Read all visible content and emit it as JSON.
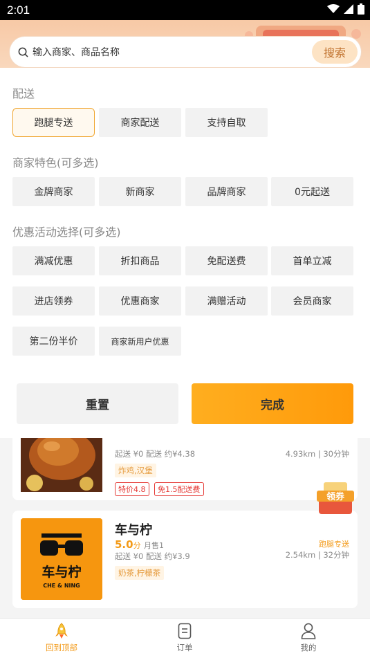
{
  "status_bar": {
    "time": "2:01"
  },
  "search": {
    "placeholder": "输入商家、商品名称",
    "button": "搜索"
  },
  "filter": {
    "delivery": {
      "title": "配送",
      "options": [
        "跑腿专送",
        "商家配送",
        "支持自取"
      ],
      "selected": "跑腿专送"
    },
    "features": {
      "title": "商家特色(可多选)",
      "options": [
        "金牌商家",
        "新商家",
        "品牌商家",
        "0元起送"
      ]
    },
    "promotions": {
      "title": "优惠活动选择(可多选)",
      "options": [
        "满减优惠",
        "折扣商品",
        "免配送费",
        "首单立减",
        "进店领券",
        "优惠商家",
        "满赠活动",
        "会员商家",
        "第二份半价",
        "商家新用户优惠"
      ]
    },
    "reset_label": "重置",
    "done_label": "完成"
  },
  "stores": [
    {
      "fees": "起送 ¥0  配送 约¥4.38",
      "distance": "4.93km | 30分钟",
      "category": "炸鸡,汉堡",
      "badges": [
        "特价4.8",
        "免1.5配送费"
      ]
    },
    {
      "name": "车与柠",
      "rating": "5.0",
      "rating_unit": "分",
      "monthly_sales": "月售1",
      "fees": "起送 ¥0  配送 约¥3.9",
      "delivery_type": "跑腿专送",
      "distance": "2.54km | 32分钟",
      "category": "奶茶,柠檬茶",
      "logo_text": "车与柠",
      "logo_subtext": "CHE & NING"
    }
  ],
  "coupon": {
    "label": "领券"
  },
  "tabbar": {
    "items": [
      {
        "label": "回到顶部",
        "icon": "rocket-icon"
      },
      {
        "label": "订单",
        "icon": "order-icon"
      },
      {
        "label": "我的",
        "icon": "user-icon"
      }
    ],
    "active": "回到顶部"
  },
  "colors": {
    "accent": "#F39A18",
    "done_button": "#FFA514",
    "badge_red": "#E53935"
  }
}
